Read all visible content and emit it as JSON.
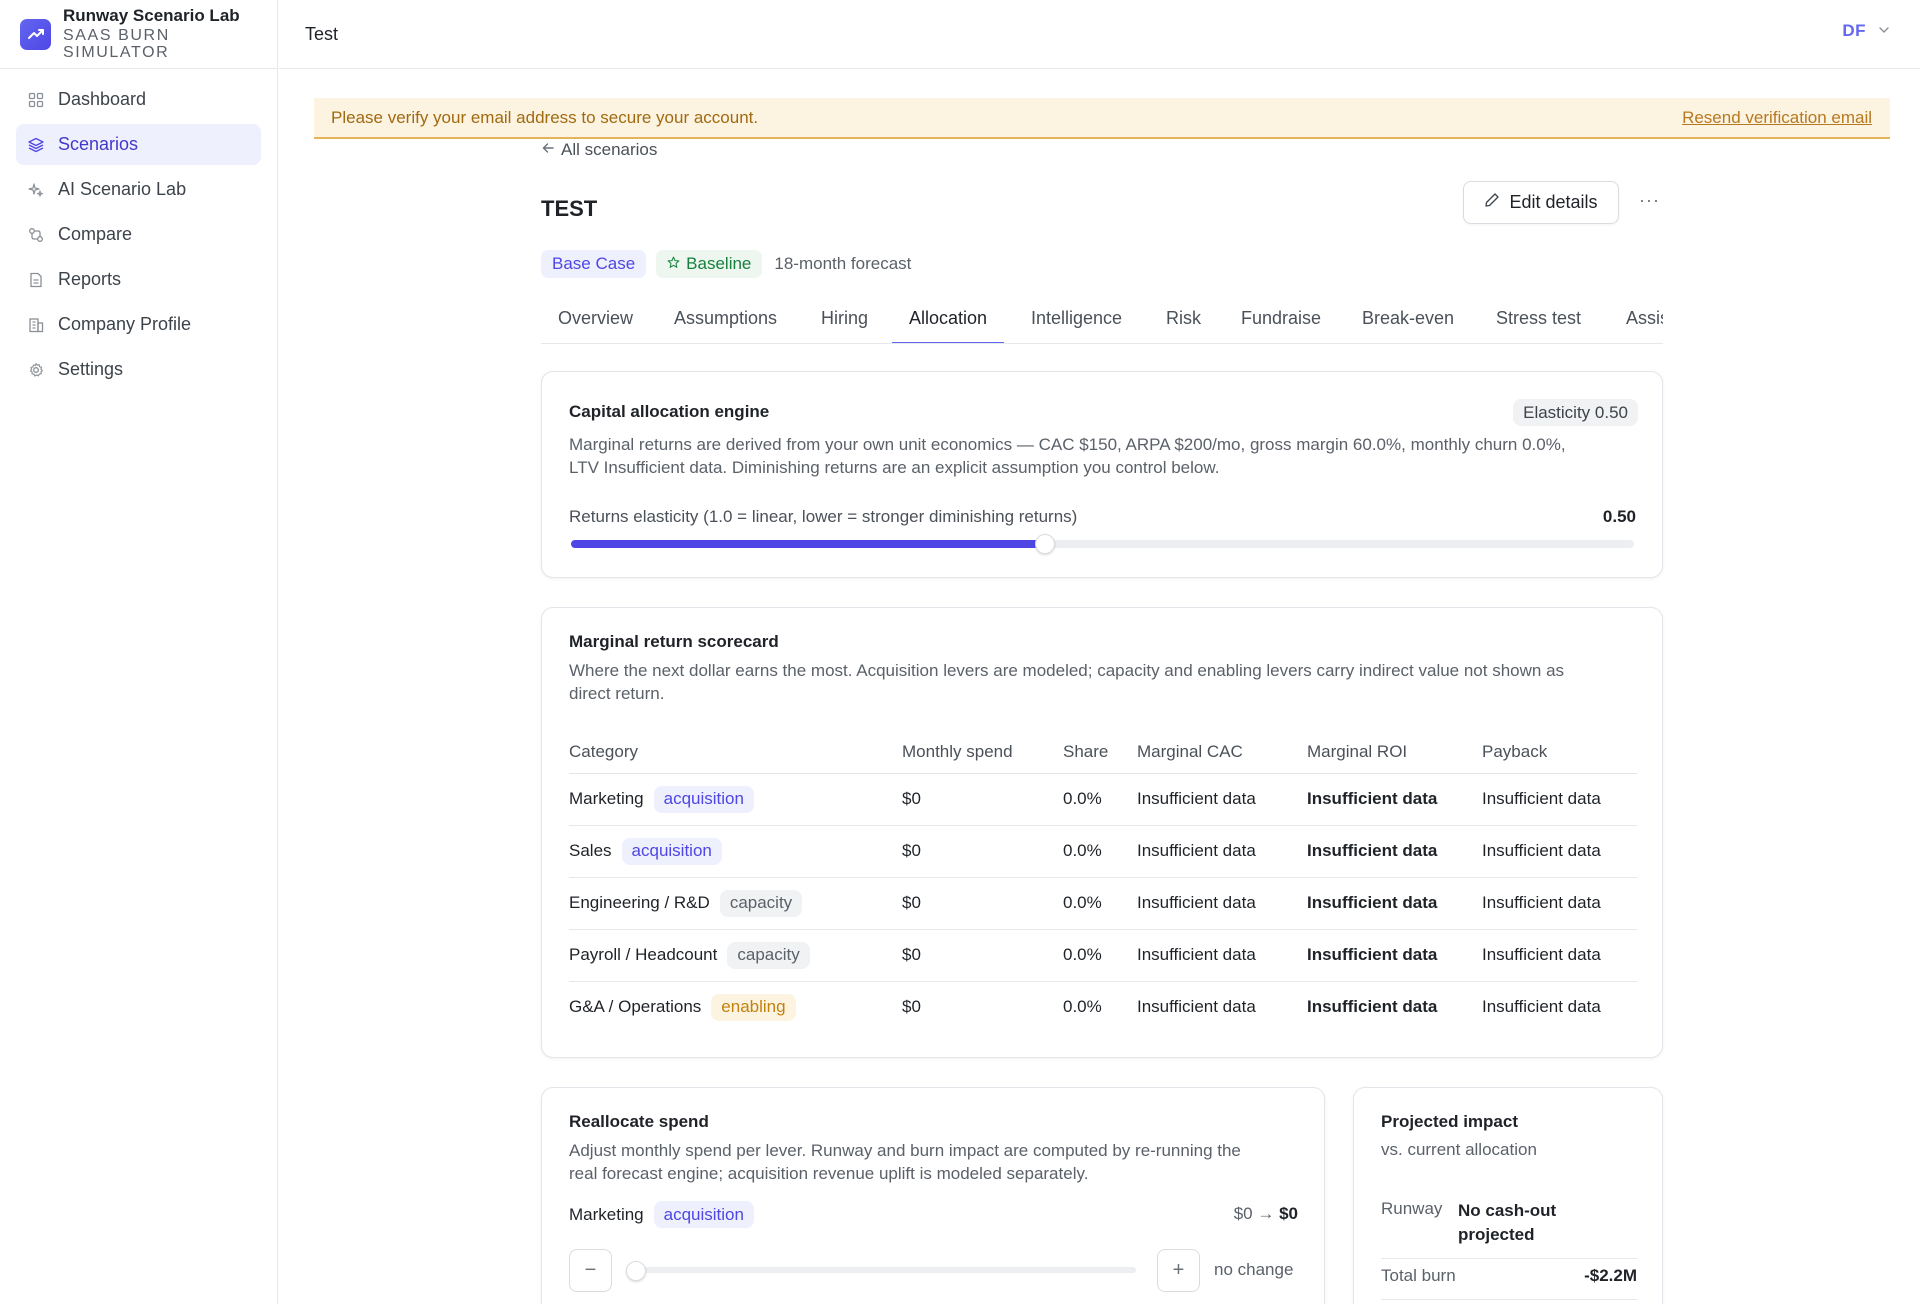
{
  "brand": {
    "title": "Runway Scenario Lab",
    "subtitle_line1": "SAAS BURN",
    "subtitle_line2": "SIMULATOR"
  },
  "sidebar": {
    "items": [
      {
        "label": "Dashboard",
        "icon": "dashboard-icon",
        "active": false
      },
      {
        "label": "Scenarios",
        "icon": "layers-icon",
        "active": true
      },
      {
        "label": "AI Scenario Lab",
        "icon": "sparkles-icon",
        "active": false
      },
      {
        "label": "Compare",
        "icon": "compare-icon",
        "active": false
      },
      {
        "label": "Reports",
        "icon": "file-icon",
        "active": false
      },
      {
        "label": "Company Profile",
        "icon": "building-icon",
        "active": false
      },
      {
        "label": "Settings",
        "icon": "gear-icon",
        "active": false
      }
    ]
  },
  "topbar": {
    "title": "Test",
    "user_initials": "DF"
  },
  "banner": {
    "text": "Please verify your email address to secure your account.",
    "link": "Resend verification email"
  },
  "page": {
    "back_link": "All scenarios",
    "title": "TEST",
    "edit_button": "Edit details",
    "more_button": "···",
    "badges": {
      "base_case": "Base Case",
      "baseline": "Baseline",
      "forecast": "18-month forecast"
    },
    "tabs": [
      "Overview",
      "Assumptions",
      "Hiring",
      "Allocation",
      "Intelligence",
      "Risk",
      "Fundraise",
      "Break-even",
      "Stress test",
      "Assis"
    ],
    "active_tab": "Allocation"
  },
  "engine": {
    "title": "Capital allocation engine",
    "elasticity_badge": "Elasticity 0.50",
    "desc_line1": "Marginal returns are derived from your own unit economics — CAC $150, ARPA $200/mo, gross margin 60.0%, monthly churn 0.0%,",
    "desc_line2": "LTV Insufficient data. Diminishing returns are an explicit assumption you control below.",
    "slider_label": "Returns elasticity (1.0 = linear, lower = stronger diminishing returns)",
    "slider_value": "0.50",
    "slider_fraction": 0.44
  },
  "scorecard": {
    "title": "Marginal return scorecard",
    "desc_line1": "Where the next dollar earns the most. Acquisition levers are modeled; capacity and enabling levers carry indirect value not shown as",
    "desc_line2": "direct return.",
    "columns": [
      "Category",
      "Monthly spend",
      "Share",
      "Marginal CAC",
      "Marginal ROI",
      "Payback"
    ],
    "rows": [
      {
        "category": "Marketing",
        "tag": "acquisition",
        "spend": "$0",
        "share": "0.0%",
        "cac": "Insufficient data",
        "roi": "Insufficient data",
        "payback": "Insufficient data"
      },
      {
        "category": "Sales",
        "tag": "acquisition",
        "spend": "$0",
        "share": "0.0%",
        "cac": "Insufficient data",
        "roi": "Insufficient data",
        "payback": "Insufficient data"
      },
      {
        "category": "Engineering / R&D",
        "tag": "capacity",
        "spend": "$0",
        "share": "0.0%",
        "cac": "Insufficient data",
        "roi": "Insufficient data",
        "payback": "Insufficient data"
      },
      {
        "category": "Payroll / Headcount",
        "tag": "capacity",
        "spend": "$0",
        "share": "0.0%",
        "cac": "Insufficient data",
        "roi": "Insufficient data",
        "payback": "Insufficient data"
      },
      {
        "category": "G&A / Operations",
        "tag": "enabling",
        "spend": "$0",
        "share": "0.0%",
        "cac": "Insufficient data",
        "roi": "Insufficient data",
        "payback": "Insufficient data"
      }
    ]
  },
  "reallocate": {
    "title": "Reallocate spend",
    "desc_line1": "Adjust monthly spend per lever. Runway and burn impact are computed by re-running the",
    "desc_line2": "real forecast engine; acquisition revenue uplift is modeled separately.",
    "lever": {
      "label": "Marketing",
      "tag": "acquisition",
      "from": "$0 →",
      "to": "$0",
      "change": "no change",
      "slider_fraction": 0.0
    },
    "minus": "−",
    "plus": "+"
  },
  "impact": {
    "title": "Projected impact",
    "subtitle": "vs. current allocation",
    "runway_label": "Runway",
    "runway_value_line1": "No cash-out",
    "runway_value_line2": "projected",
    "burn_label": "Total burn",
    "burn_value": "-$2.2M"
  },
  "colors": {
    "accent": "#4f46e5",
    "warning_bg": "#fdf3e1",
    "warning_text": "#a06a10",
    "success": "#16803c"
  }
}
